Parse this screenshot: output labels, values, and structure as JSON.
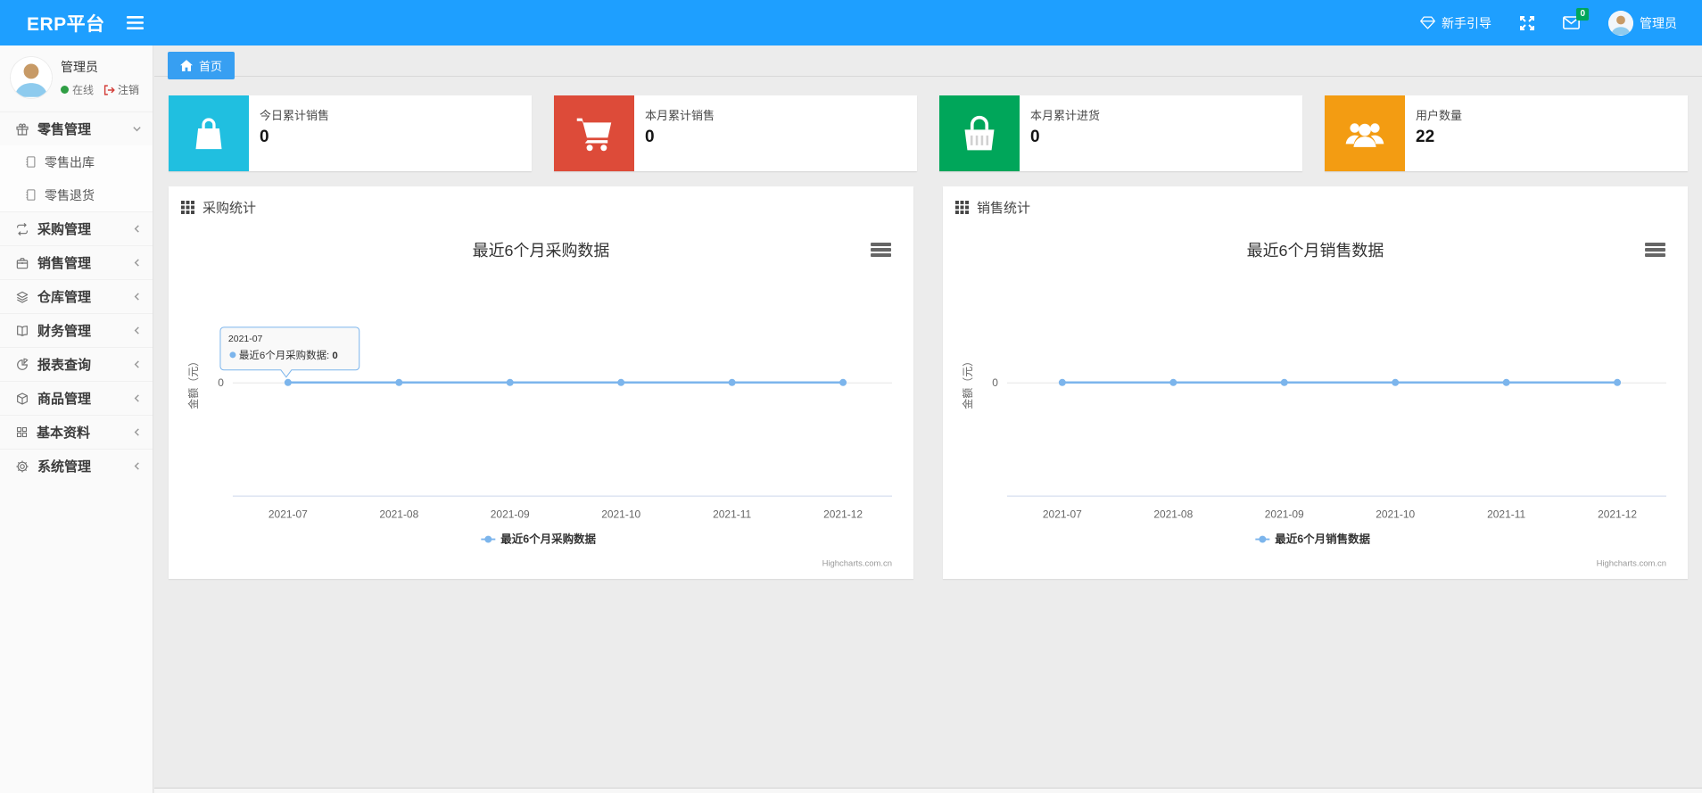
{
  "navbar": {
    "brand": "ERP平台",
    "guide_label": "新手引导",
    "mail_badge": "0",
    "username": "管理员"
  },
  "sidebar": {
    "user": {
      "name": "管理员",
      "status_label": "在线",
      "logout_label": "注销"
    },
    "items": [
      {
        "key": "retail",
        "icon": "gift-icon",
        "label": "零售管理",
        "expanded": true,
        "children": [
          {
            "key": "retail-out",
            "icon": "file-icon",
            "label": "零售出库"
          },
          {
            "key": "retail-return",
            "icon": "file-icon",
            "label": "零售退货"
          }
        ]
      },
      {
        "key": "purchase",
        "icon": "repeat-icon",
        "label": "采购管理",
        "expanded": false
      },
      {
        "key": "sales",
        "icon": "briefcase-icon",
        "label": "销售管理",
        "expanded": false
      },
      {
        "key": "warehouse",
        "icon": "layers-icon",
        "label": "仓库管理",
        "expanded": false
      },
      {
        "key": "finance",
        "icon": "book-icon",
        "label": "财务管理",
        "expanded": false
      },
      {
        "key": "reports",
        "icon": "pie-chart-icon",
        "label": "报表查询",
        "expanded": false
      },
      {
        "key": "goods",
        "icon": "box-icon",
        "label": "商品管理",
        "expanded": false
      },
      {
        "key": "basic-data",
        "icon": "grid-icon",
        "label": "基本资料",
        "expanded": false
      },
      {
        "key": "system",
        "icon": "gear-icon",
        "label": "系统管理",
        "expanded": false
      }
    ]
  },
  "tabs": {
    "home_label": "首页"
  },
  "cards": [
    {
      "key": "today-sales",
      "label": "今日累计销售",
      "value": "0",
      "color": "#20bfe0",
      "icon": "shopping-bag-icon"
    },
    {
      "key": "month-sales",
      "label": "本月累计销售",
      "value": "0",
      "color": "#dd4b39",
      "icon": "shopping-cart-icon"
    },
    {
      "key": "month-purchase",
      "label": "本月累计进货",
      "value": "0",
      "color": "#00a65a",
      "icon": "shopping-basket-icon"
    },
    {
      "key": "user-count",
      "label": "用户数量",
      "value": "22",
      "color": "#f39c12",
      "icon": "users-icon"
    }
  ],
  "panels": [
    {
      "key": "purchase-stats",
      "title": "采购统计"
    },
    {
      "key": "sales-stats",
      "title": "销售统计"
    }
  ],
  "chart_data": [
    {
      "type": "line",
      "title": "最近6个月采购数据",
      "categories": [
        "2021-07",
        "2021-08",
        "2021-09",
        "2021-10",
        "2021-11",
        "2021-12"
      ],
      "series": [
        {
          "name": "最近6个月采购数据",
          "color": "#7cb5ec",
          "values": [
            0,
            0,
            0,
            0,
            0,
            0
          ]
        }
      ],
      "xlabel": "",
      "ylabel": "金额（元）",
      "yticks": [
        "0"
      ],
      "grid": true,
      "legend_position": "bottom",
      "credits": "Highcharts.com.cn",
      "tooltip": {
        "category": "2021-07",
        "series": "最近6个月采购数据",
        "value": "0"
      }
    },
    {
      "type": "line",
      "title": "最近6个月销售数据",
      "categories": [
        "2021-07",
        "2021-08",
        "2021-09",
        "2021-10",
        "2021-11",
        "2021-12"
      ],
      "series": [
        {
          "name": "最近6个月销售数据",
          "color": "#7cb5ec",
          "values": [
            0,
            0,
            0,
            0,
            0,
            0
          ]
        }
      ],
      "xlabel": "",
      "ylabel": "金额（元）",
      "yticks": [
        "0"
      ],
      "grid": true,
      "legend_position": "bottom",
      "credits": "Highcharts.com.cn",
      "tooltip": null
    }
  ]
}
